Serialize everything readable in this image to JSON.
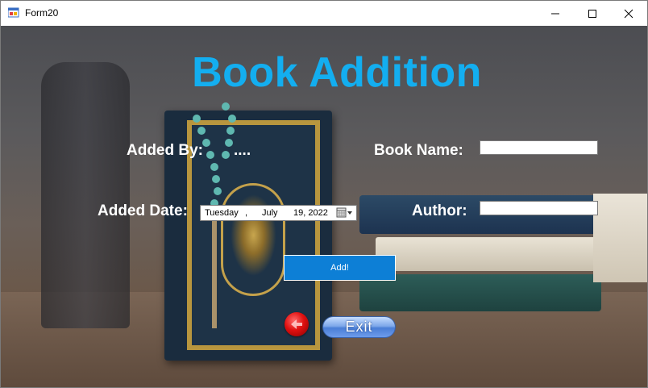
{
  "window": {
    "title": "Form20",
    "controls": {
      "minimize_icon": "minimize-icon",
      "maximize_icon": "maximize-icon",
      "close_icon": "close-icon"
    }
  },
  "form": {
    "heading": "Book Addition",
    "added_by_label": "Added By:",
    "added_by_value": "....",
    "added_date_label": "Added Date:",
    "date_picker": {
      "weekday": "Tuesday",
      "sep": ",",
      "month": "July",
      "day_year": "19, 2022"
    },
    "book_name_label": "Book Name:",
    "book_name_value": "",
    "author_label": "Author:",
    "author_value": "",
    "add_button": "Add!",
    "exit_button": "Exit"
  },
  "colors": {
    "heading": "#13aef0",
    "add_button": "#0d7fd6"
  }
}
